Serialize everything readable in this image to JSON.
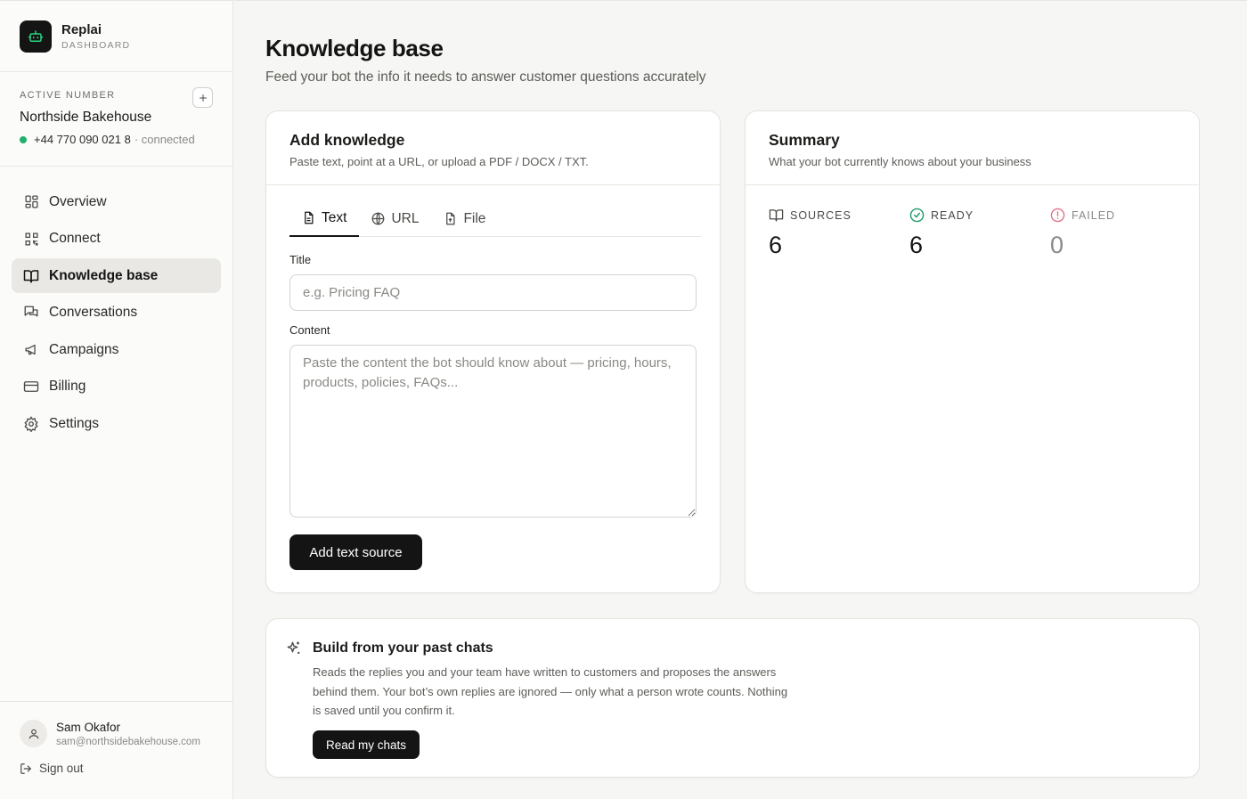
{
  "app": {
    "name": "Replai",
    "subtitle": "DASHBOARD"
  },
  "active_number": {
    "label": "ACTIVE NUMBER",
    "business_name": "Northside Bakehouse",
    "phone": "+44 770 090 021 8",
    "status": "· connected",
    "status_color": "#1fb06a"
  },
  "nav": {
    "items": [
      {
        "label": "Overview",
        "icon": "grid-icon"
      },
      {
        "label": "Connect",
        "icon": "qr-code-icon"
      },
      {
        "label": "Knowledge base",
        "icon": "book-icon",
        "active": true
      },
      {
        "label": "Conversations",
        "icon": "chat-icon"
      },
      {
        "label": "Campaigns",
        "icon": "megaphone-icon"
      },
      {
        "label": "Billing",
        "icon": "credit-card-icon"
      },
      {
        "label": "Settings",
        "icon": "gear-icon"
      }
    ]
  },
  "user": {
    "name": "Sam Okafor",
    "email": "sam@northsidebakehouse.com",
    "sign_out": "Sign out"
  },
  "page": {
    "title": "Knowledge base",
    "subtitle": "Feed your bot the info it needs to answer customer questions accurately"
  },
  "add_knowledge": {
    "title": "Add knowledge",
    "description": "Paste text, point at a URL, or upload a PDF / DOCX / TXT.",
    "tabs": [
      {
        "label": "Text",
        "icon": "document-icon",
        "active": true
      },
      {
        "label": "URL",
        "icon": "globe-icon"
      },
      {
        "label": "File",
        "icon": "file-upload-icon"
      }
    ],
    "title_field": {
      "label": "Title",
      "placeholder": "e.g. Pricing FAQ",
      "value": ""
    },
    "content_field": {
      "label": "Content",
      "placeholder": "Paste the content the bot should know about — pricing, hours, products, policies, FAQs...",
      "value": ""
    },
    "submit_label": "Add text source"
  },
  "summary": {
    "title": "Summary",
    "description": "What your bot currently knows about your business",
    "stats": [
      {
        "label": "SOURCES",
        "value": "6",
        "icon": "book-icon"
      },
      {
        "label": "READY",
        "value": "6",
        "icon": "check-circle-icon",
        "color": "#1f9a6a"
      },
      {
        "label": "FAILED",
        "value": "0",
        "icon": "alert-circle-icon",
        "color": "#e0738a"
      }
    ]
  },
  "build": {
    "title": "Build from your past chats",
    "description": "Reads the replies you and your team have written to customers and proposes the answers behind them. Your bot’s own replies are ignored — only what a person wrote counts. Nothing is saved until you confirm it.",
    "button_label": "Read my chats",
    "icon": "sparkle-icon"
  }
}
